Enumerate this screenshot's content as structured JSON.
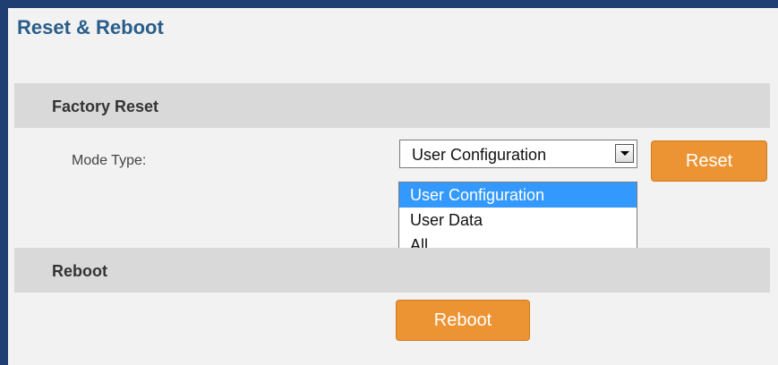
{
  "page": {
    "title": "Reset & Reboot"
  },
  "factory_reset": {
    "header": "Factory Reset",
    "mode_type_label": "Mode Type:",
    "mode_type": {
      "selected": "User Configuration",
      "options": [
        "User Configuration",
        "User Data",
        "All"
      ],
      "highlighted_index": 0,
      "dropdown_open": true
    },
    "reset_button": "Reset"
  },
  "reboot": {
    "header": "Reboot",
    "reboot_button": "Reboot"
  },
  "colors": {
    "frame": "#1f3f73",
    "title": "#2a5d8a",
    "button": "#ec9433",
    "highlight": "#3399ff",
    "section_bg": "#d9d9d9"
  }
}
